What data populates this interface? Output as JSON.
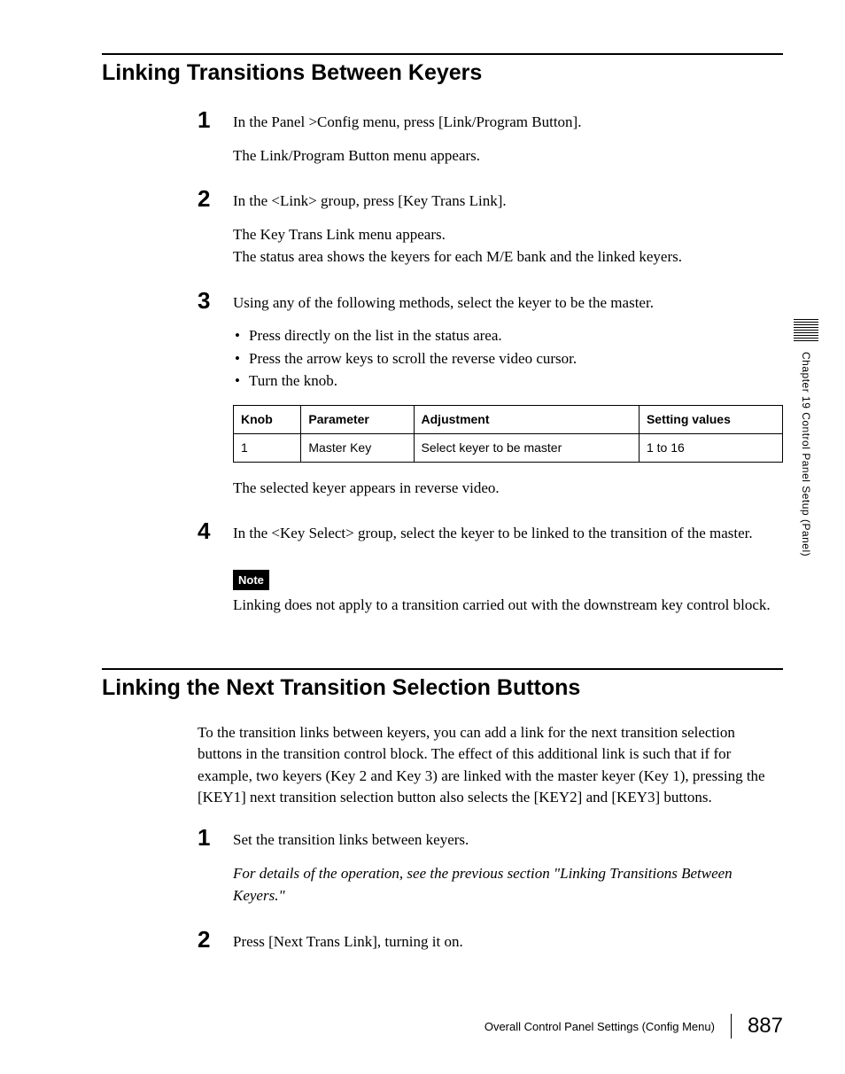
{
  "section1": {
    "title": "Linking Transitions Between Keyers",
    "steps": [
      {
        "num": "1",
        "lines": [
          "In the Panel >Config menu, press [Link/Program Button].",
          "The Link/Program Button menu appears."
        ]
      },
      {
        "num": "2",
        "lines": [
          "In the <Link> group, press [Key Trans Link].",
          "The Key Trans Link menu appears.",
          "The status area shows the keyers for each M/E bank and the linked keyers."
        ]
      },
      {
        "num": "3",
        "lines": [
          "Using any of the following methods, select the keyer to be the master."
        ],
        "bullets": [
          "Press directly on the list in the status area.",
          "Press the arrow keys to scroll the reverse video cursor.",
          "Turn the knob."
        ],
        "afterTable": "The selected keyer appears in reverse video."
      },
      {
        "num": "4",
        "lines": [
          "In the <Key Select> group, select the keyer to be linked to the transition of the master."
        ],
        "noteLabel": "Note",
        "noteText": "Linking does not apply to a transition carried out with the downstream key control block."
      }
    ],
    "table": {
      "headers": [
        "Knob",
        "Parameter",
        "Adjustment",
        "Setting values"
      ],
      "rows": [
        [
          "1",
          "Master Key",
          "Select keyer to be master",
          "1 to 16"
        ]
      ]
    }
  },
  "section2": {
    "title": "Linking the Next Transition Selection Buttons",
    "intro": "To the transition links between keyers, you can add a link for the next transition selection buttons in the transition control block. The effect of this additional link is such that if for example, two keyers (Key 2 and Key 3) are linked with the master keyer (Key 1), pressing the [KEY1] next transition selection button also selects the [KEY2] and [KEY3] buttons.",
    "steps": [
      {
        "num": "1",
        "lines": [
          "Set the transition links between keyers."
        ],
        "italicNote": "For details of the operation, see the previous section \"Linking Transitions Between Keyers.\""
      },
      {
        "num": "2",
        "lines": [
          "Press [Next Trans Link], turning it on."
        ]
      }
    ]
  },
  "sidebar": "Chapter 19   Control Panel Setup (Panel)",
  "footer": {
    "text": "Overall Control Panel Settings (Config Menu)",
    "page": "887"
  }
}
